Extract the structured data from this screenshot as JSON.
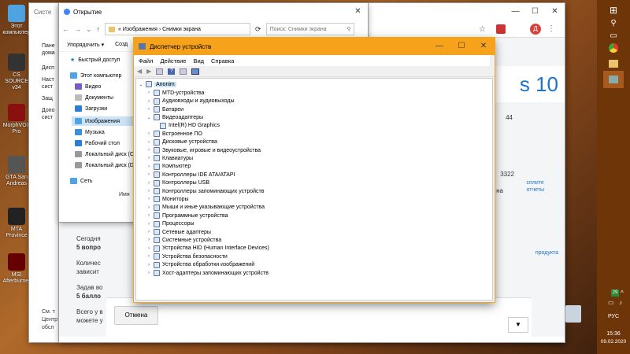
{
  "desktop": {
    "icons": [
      {
        "label": "Этот компьютер"
      },
      {
        "label": "CS SOURCE v34"
      },
      {
        "label": "MorphVOX Pro"
      },
      {
        "label": "GTA San Andreas"
      },
      {
        "label": "MTA Province"
      },
      {
        "label": "MSI Afterburner"
      }
    ]
  },
  "explorer": {
    "title": "Снимки экрана",
    "title_partial": "Систе",
    "ribbon": {
      "arrange": "Упорядочить ▾",
      "create": "Созд"
    },
    "address": [
      "Изображения",
      "Снимки экрана"
    ],
    "search_placeholder": "Поиск: Снимки экрана",
    "nav": [
      {
        "label": "Быстрый доступ"
      },
      {
        "label": "Этот компьютер"
      },
      {
        "label": "Видео"
      },
      {
        "label": "Документы"
      },
      {
        "label": "Загрузки"
      },
      {
        "label": "Изображения"
      },
      {
        "label": "Музыка"
      },
      {
        "label": "Рабочий стол"
      },
      {
        "label": "Локальный диск (С"
      },
      {
        "label": "Локальный диск (D"
      },
      {
        "label": "Сеть"
      }
    ],
    "column": "Имя",
    "side_labels": [
      "Пане",
      "дома",
      "Дисп",
      "Наст",
      "сист",
      "Защ",
      "Допо",
      "сист"
    ]
  },
  "chrome": {
    "title": "Открытие",
    "avatar": "Д",
    "page": {
      "big": "s 10",
      "num1": "44",
      "num2": "3322",
      "na": "на",
      "links": [
        "сплите",
        "отчеты"
      ],
      "link3": "продукта",
      "text": [
        {
          "lead": "Сегодня",
          "bold": "5 вопро"
        },
        {
          "lead": "Количес",
          "bold": "зависит"
        },
        {
          "lead": "Задав во",
          "bold": "5 балло"
        },
        {
          "lead": "Всего у в",
          "bold": "можете у"
        }
      ],
      "footnote": [
        "См. т",
        "Центр",
        "обсл"
      ],
      "cancel": "Отмена"
    }
  },
  "devmgr": {
    "title": "Диспетчер устройств",
    "menu": [
      "Файл",
      "Действие",
      "Вид",
      "Справка"
    ],
    "root": "Anonim",
    "items": [
      {
        "label": "MTD-устройства",
        "expanded": false
      },
      {
        "label": "Аудиовходы и аудиовыходы",
        "expanded": false
      },
      {
        "label": "Батареи",
        "expanded": false
      },
      {
        "label": "Видеоадаптеры",
        "expanded": true
      },
      {
        "label": "Intel(R) HD Graphics",
        "child": true
      },
      {
        "label": "Встроенное ПО",
        "expanded": false
      },
      {
        "label": "Дисковые устройства",
        "expanded": false
      },
      {
        "label": "Звуковые, игровые и видеоустройства",
        "expanded": false
      },
      {
        "label": "Клавиатуры",
        "expanded": false
      },
      {
        "label": "Компьютер",
        "expanded": false
      },
      {
        "label": "Контроллеры IDE ATA/ATAPI",
        "expanded": false
      },
      {
        "label": "Контроллеры USB",
        "expanded": false
      },
      {
        "label": "Контроллеры запоминающих устройств",
        "expanded": false
      },
      {
        "label": "Мониторы",
        "expanded": false
      },
      {
        "label": "Мыши и иные указывающие устройства",
        "expanded": false
      },
      {
        "label": "Программные устройства",
        "expanded": false
      },
      {
        "label": "Процессоры",
        "expanded": false
      },
      {
        "label": "Сетевые адаптеры",
        "expanded": false
      },
      {
        "label": "Системные устройства",
        "expanded": false
      },
      {
        "label": "Устройства HID (Human Interface Devices)",
        "expanded": false
      },
      {
        "label": "Устройства безопасности",
        "expanded": false
      },
      {
        "label": "Устройства обработки изображений",
        "expanded": false
      },
      {
        "label": "Хост-адаптеры запоминающих устройств",
        "expanded": false
      }
    ]
  },
  "taskbar": {
    "lang": "РУС",
    "time": "15:36",
    "date": "09.02.2020",
    "badge": "29"
  },
  "colors": {
    "devmgr_title": "#f7a21b",
    "taskbar": "#6e3608",
    "accent": "#1e73c8"
  }
}
